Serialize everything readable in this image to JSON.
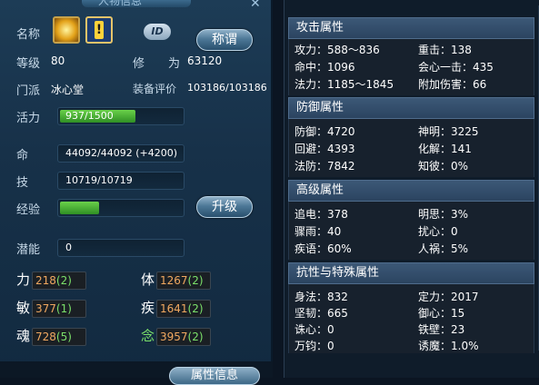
{
  "character": {
    "window_title": "人物信息",
    "name_label": "名称",
    "id_badge": "ID",
    "title_button": "称谓",
    "level_label": "等级",
    "level_value": "80",
    "cultivation_label": "修　　为",
    "cultivation_value": "63120",
    "sect_label": "门派",
    "sect_value": "冰心堂",
    "gear_score_label": "装备评价",
    "gear_score_value": "103186/103186",
    "vitality_label": "活力",
    "vitality_value": "937/1500",
    "vitality_fraction": 0.62,
    "hp_label": "命",
    "hp_value": "44092/44092 (+4200)",
    "skill_label": "技",
    "skill_value": "10719/10719",
    "exp_label": "经验",
    "exp_fraction": 0.32,
    "upgrade_button": "升级",
    "potential_label": "潜能",
    "potential_value": "0",
    "bottom_button": "属性信息"
  },
  "stats": [
    {
      "label": "力",
      "base": "218",
      "bonus": "(2)"
    },
    {
      "label": "体",
      "base": "1267",
      "bonus": "(2)"
    },
    {
      "label": "敏",
      "base": "377",
      "bonus": "(1)"
    },
    {
      "label": "疾",
      "base": "1641",
      "bonus": "(2)"
    },
    {
      "label": "魂",
      "base": "728",
      "bonus": "(5)"
    },
    {
      "label": "念",
      "base": "3957",
      "bonus": "(2)"
    }
  ],
  "attributes": {
    "attack": {
      "title": "攻击属性",
      "items": [
        "攻力：588～836",
        "重击：138",
        "命中：1096",
        "会心一击：435",
        "法力：1185～1845",
        "附加伤害：66"
      ]
    },
    "defense": {
      "title": "防御属性",
      "items": [
        "防御：4720",
        "神明：3225",
        "回避：4393",
        "化解：141",
        "法防：7842",
        "知彼：0%"
      ]
    },
    "advanced": {
      "title": "高级属性",
      "items": [
        "追电：378",
        "明思：3%",
        "骤雨：40",
        "扰心：0",
        "疾语：60%",
        "人祸：5%"
      ]
    },
    "resist": {
      "title": "抗性与特殊属性",
      "items": [
        "身法：832",
        "定力：2017",
        "坚韧：665",
        "御心：15",
        "诛心：0",
        "铁壁：23",
        "万钧：0",
        "诱魔：1.0%"
      ]
    }
  },
  "colors": {
    "bar_green": "#4cb83a",
    "stat_base": "#f0a860",
    "stat_bonus": "#7be06a",
    "section_header": "#34506e"
  }
}
